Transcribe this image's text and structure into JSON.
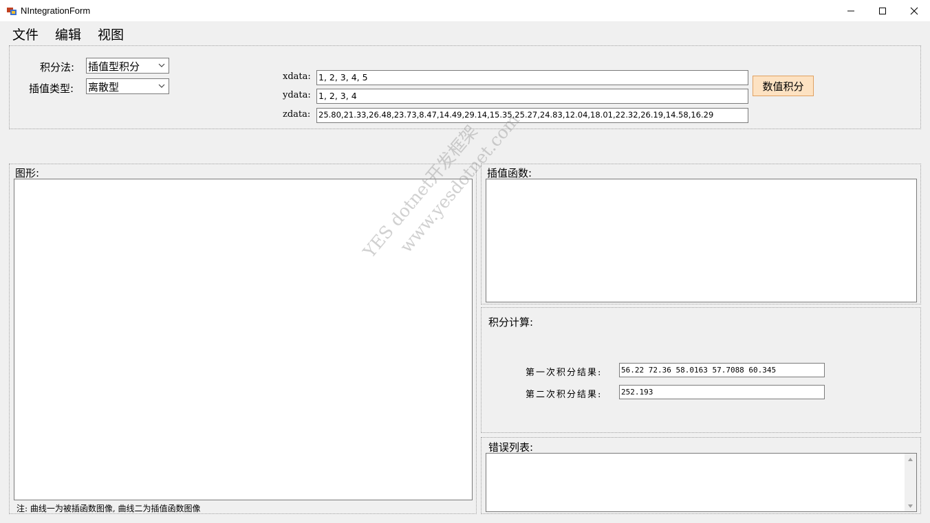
{
  "window": {
    "title": "NIntegrationForm"
  },
  "menu": {
    "file": "文件",
    "edit": "编辑",
    "view": "视图"
  },
  "params": {
    "method_label": "积分法:",
    "method_value": "插值型积分",
    "interp_label": "插值类型:",
    "interp_value": "离散型",
    "xdata_label": "xdata:",
    "xdata_value": "1, 2, 3, 4, 5",
    "ydata_label": "ydata:",
    "ydata_value": "1, 2, 3, 4",
    "zdata_label": "zdata:",
    "zdata_value": "25.80,21.33,26.48,23.73,8.47,14.49,29.14,15.35,25.27,24.83,12.04,18.01,22.32,26.19,14.58,16.29",
    "integrate_button": "数值积分"
  },
  "graph": {
    "label": "图形:",
    "note": "注: 曲线一为被插函数图像, 曲线二为插值函数图像"
  },
  "interp_func": {
    "label": "插值函数:"
  },
  "integral": {
    "label": "积分计算:",
    "first_label": "第一次积分结果:",
    "first_value": "56.22  72.36  58.0163  57.7088  60.345",
    "second_label": "第二次积分结果:",
    "second_value": "252.193"
  },
  "errors": {
    "label": "错误列表:"
  },
  "watermark": {
    "line1": "YES dotnet开发框架",
    "line2": "www.yesdotnet.com"
  },
  "icons": {
    "app": "app-form-icon",
    "minimize": "minimize-icon",
    "maximize": "maximize-icon",
    "close": "close-icon",
    "dropdown": "chevron-down-icon",
    "scroll_up": "scroll-up-icon",
    "scroll_down": "scroll-down-icon"
  }
}
